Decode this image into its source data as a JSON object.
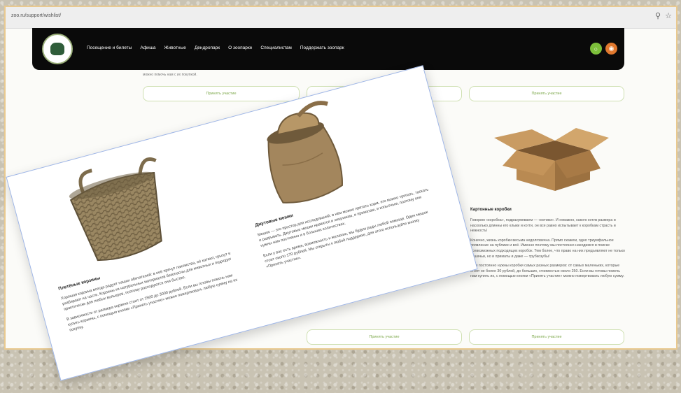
{
  "browser": {
    "url": "zoo.ru/support/wishlist/"
  },
  "nav": {
    "items": [
      "Посещение и билеты",
      "Афиша",
      "Животные",
      "Дендропарк",
      "О зоопарке",
      "Специалистам",
      "Поддержать зоопарк"
    ]
  },
  "content": {
    "snippet": "можно помочь нам с их покупкой.",
    "participate_label": "Принять участие",
    "box": {
      "title": "Картонные коробки",
      "paragraphs": [
        "Говорим «коробка», подразумеваем — «котики». И неважно, какого котик размера и насколько длинны его клыки и когти, он все равно испытывает к коробкам страсть и нежность!",
        "Конечно, жизнь коробки весьма недолговечна. Прямо скажем, одно триумфальное появление на публике и всё. Именно поэтому мы постоянно находимся в поиске всевозможных подходящих коробок. Тем более, что право на них предъявляют не только кошачьи, но и приматы и даже — трубкозубы!",
        "Нам постоянно нужны коробки самых разных размеров: от самых маленьких, которые стоят не более 30 рублей, до больших, стоимостью около 250. Если вы готовы помочь нам купить их, с помощью кнопки «Принять участие» можно пожертвовать любую сумму."
      ]
    }
  },
  "overlay": {
    "basket": {
      "title": "Плетёные корзины",
      "paragraphs": [
        "Хорошая корзина всегда радует наших обитателей: в неё прячут лакомства, её катают, грызут и разбирают на части. Корзины из натуральных материалов безопасны для животных и подходят практически для любых вольеров, поэтому расходуются они быстро.",
        "В зависимости от размера корзина стоит от 1500 до 3000 рублей. Если вы готовы помочь нам купить корзины, с помощью кнопки «Принять участие» можно пожертвовать любую сумму на их покупку."
      ]
    },
    "sack": {
      "title": "Джутовые мешки",
      "paragraphs": [
        "Мешок — это простор для исследований: в нём можно прятать корм, его можно трепать, таскать и разрывать. Джутовые мешки нравятся и хищникам, и приматам, и копытным, поэтому они нужны нам постоянно и в больших количествах.",
        "Если у вас есть время, возможность и желание, мы будем рады любой помощи. Один мешок стоит около 170 рублей. Мы открыты к любой поддержке, для этого используйте кнопку «Принять участие»."
      ]
    }
  }
}
